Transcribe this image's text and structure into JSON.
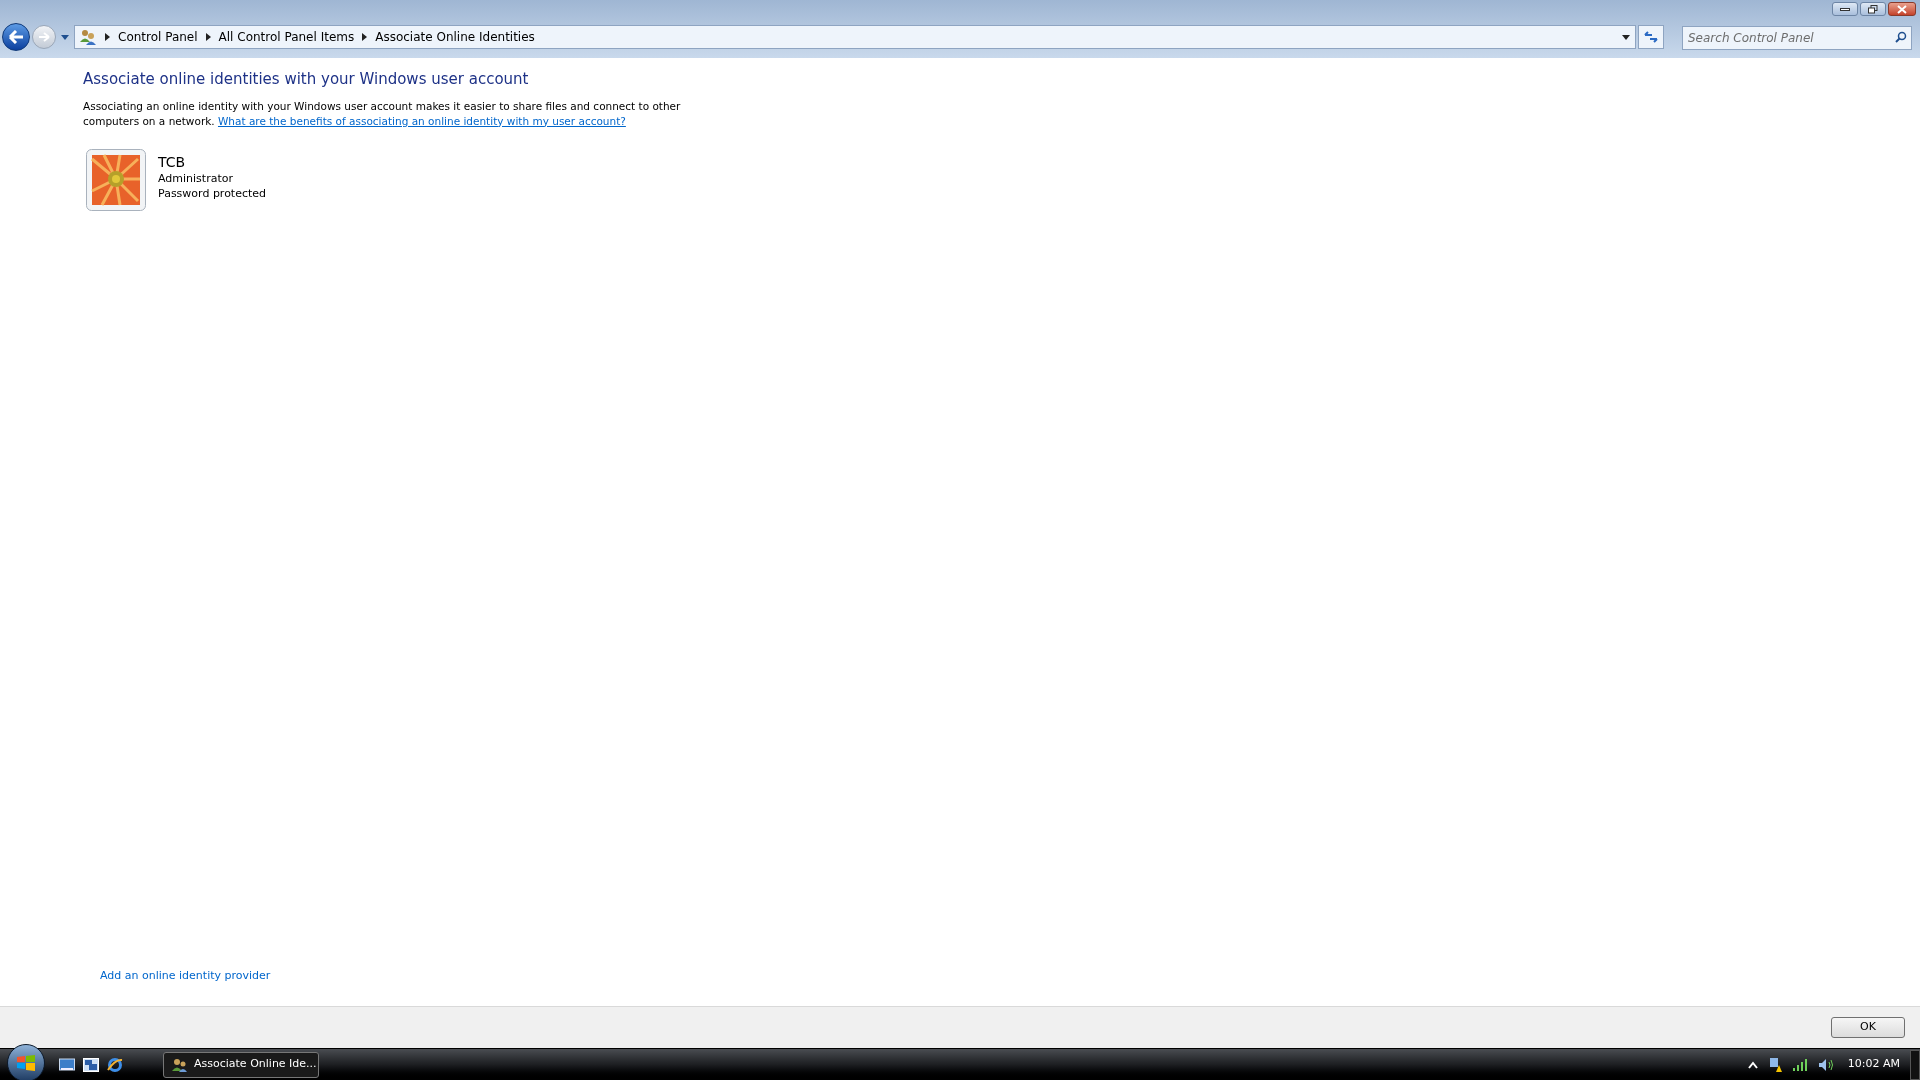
{
  "breadcrumb": [
    "Control Panel",
    "All Control Panel Items",
    "Associate Online Identities"
  ],
  "search": {
    "placeholder": "Search Control Panel"
  },
  "heading": "Associate online identities with your Windows user account",
  "description": "Associating an online identity with your Windows user account makes it easier to share files and connect to other computers on a network.",
  "help_link": "What are the benefits of associating an online identity with my user account?",
  "account": {
    "name": "TCB",
    "role": "Administrator",
    "status": "Password protected"
  },
  "add_provider_link": "Add an online identity provider",
  "ok_button": "OK",
  "taskbar": {
    "window_button": "Associate Online Ide...",
    "clock": "10:02 AM"
  }
}
